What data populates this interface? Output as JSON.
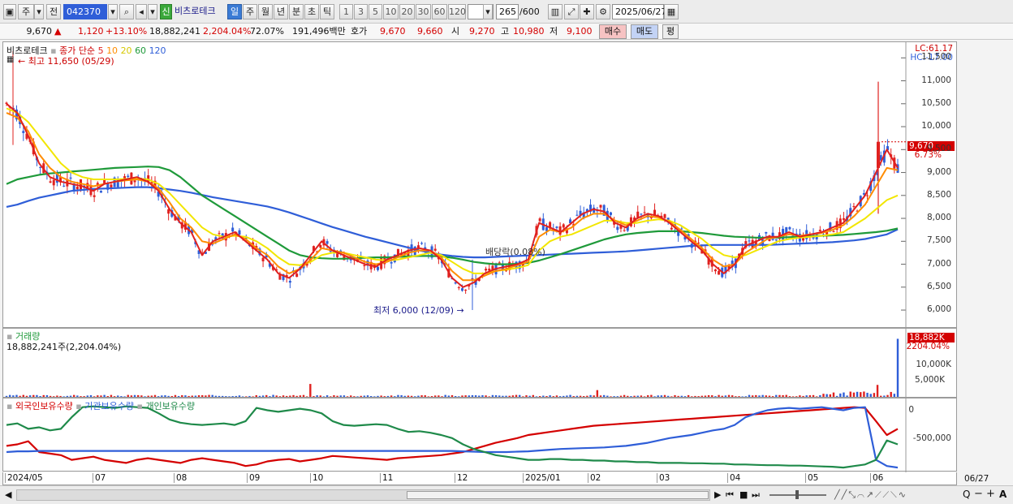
{
  "toolbar": {
    "market": "주",
    "all": "전",
    "code": "042370",
    "credit_badge": "신",
    "stock_name": "비츠로테크",
    "periods": [
      "일",
      "주",
      "월",
      "년",
      "분",
      "초",
      "틱"
    ],
    "numbers": [
      "1",
      "3",
      "5",
      "10",
      "20",
      "30",
      "60",
      "120"
    ],
    "count": "265",
    "count_total": "/600",
    "date": "2025/06/27"
  },
  "quote": {
    "price": "9,670",
    "up_arrow": "▲",
    "change": "1,120",
    "rate": "+13.10%",
    "volume": "18,882,241",
    "vol_rate": "2,204.04%",
    "turnover": "72.07%",
    "amount": "191,496백만",
    "hoga_label": "호가",
    "ask": "9,670",
    "bid": "9,660",
    "open_label": "시",
    "open": "9,270",
    "high_label": "고",
    "high": "10,980",
    "low_label": "저",
    "low": "9,100",
    "buy": "매수",
    "sell": "매도",
    "avg": "평"
  },
  "price_panel": {
    "name": "비츠로테크",
    "legend_prefix": "종가 단순",
    "ma": [
      {
        "label": "5",
        "color": "#e0211f"
      },
      {
        "label": "10",
        "color": "#ff8c00"
      },
      {
        "label": "20",
        "color": "#f2e600"
      },
      {
        "label": "60",
        "color": "#1f9a3a"
      },
      {
        "label": "120",
        "color": "#2f5ed8"
      }
    ],
    "high_note": "최고 11,650 (05/29)",
    "low_note": "최저 6,000 (12/09)",
    "dividend_note": "배당락(0.08%)",
    "lc": "LC:61.17",
    "hc": "HC:-17.00",
    "last_price": "9,670",
    "last_rate": "6.73%",
    "y_ticks": [
      "11,500",
      "11,000",
      "10,500",
      "10,000",
      "9,500",
      "9,000",
      "8,500",
      "8,000",
      "7,500",
      "7,000",
      "6,500",
      "6,000"
    ]
  },
  "volume_panel": {
    "title": "거래량",
    "value": "18,882,241주(2,204.04%)",
    "last_value": "18,882K",
    "last_rate": "2204.04%",
    "y_ticks": [
      "10,000K",
      "5,000K"
    ]
  },
  "holdings_panel": {
    "series": [
      {
        "name": "외국인보유수량",
        "color": "#d40000"
      },
      {
        "name": "기관보유수량",
        "color": "#2f5ed8"
      },
      {
        "name": "개인보유수량",
        "color": "#1f8a4a"
      }
    ],
    "y_ticks": [
      "0",
      "-500,000"
    ]
  },
  "x_axis": [
    "2024/05",
    "07",
    "08",
    "09",
    "10",
    "11",
    "12",
    "2025/01",
    "02",
    "03",
    "04",
    "05",
    "06"
  ],
  "x_axis_right": "06/27",
  "chart_data": [
    {
      "type": "line",
      "title": "비츠로테크",
      "ylim": [
        5700,
        11700
      ],
      "high": 11650,
      "low": 6000,
      "last": 9670,
      "ma5": [
        10500,
        10300,
        9800,
        9200,
        8900,
        8800,
        8750,
        8700,
        8600,
        8750,
        8800,
        8850,
        8900,
        8800,
        8600,
        8200,
        7900,
        7700,
        7200,
        7500,
        7600,
        7700,
        7500,
        7300,
        7100,
        6800,
        6700,
        6900,
        7200,
        7500,
        7300,
        7200,
        7100,
        7000,
        6950,
        7100,
        7200,
        7300,
        7350,
        7300,
        7100,
        6700,
        6500,
        6600,
        6800,
        6900,
        6950,
        7000,
        7100,
        7900,
        7800,
        7700,
        7900,
        8100,
        8200,
        8150,
        7900,
        7800,
        8000,
        8100,
        8050,
        7900,
        7700,
        7500,
        7300,
        7000,
        6800,
        7000,
        7400,
        7500,
        7600,
        7600,
        7700,
        7600,
        7650,
        7700,
        7800,
        7900,
        8200,
        8500,
        9000,
        9500,
        9100
      ],
      "ma10": [
        10300,
        10200,
        9900,
        9400,
        9100,
        8900,
        8800,
        8750,
        8700,
        8750,
        8800,
        8830,
        8850,
        8800,
        8650,
        8350,
        8000,
        7800,
        7500,
        7450,
        7550,
        7650,
        7550,
        7350,
        7200,
        6950,
        6800,
        6900,
        7100,
        7350,
        7300,
        7250,
        7150,
        7050,
        7000,
        7050,
        7150,
        7250,
        7300,
        7300,
        7150,
        6850,
        6650,
        6650,
        6750,
        6850,
        6900,
        6980,
        7050,
        7600,
        7750,
        7700,
        7800,
        8000,
        8100,
        8100,
        7950,
        7850,
        7950,
        8050,
        8020,
        7930,
        7750,
        7550,
        7350,
        7100,
        6950,
        7000,
        7250,
        7400,
        7550,
        7600,
        7650,
        7620,
        7650,
        7680,
        7750,
        7850,
        8050,
        8300,
        8700,
        9100,
        9050
      ],
      "ma20": [
        10400,
        10300,
        10100,
        9800,
        9500,
        9200,
        9000,
        8900,
        8850,
        8850,
        8850,
        8860,
        8870,
        8850,
        8750,
        8550,
        8300,
        8050,
        7800,
        7650,
        7600,
        7620,
        7600,
        7500,
        7350,
        7150,
        7000,
        6980,
        7050,
        7200,
        7250,
        7250,
        7200,
        7150,
        7100,
        7080,
        7100,
        7150,
        7200,
        7250,
        7200,
        7050,
        6900,
        6800,
        6800,
        6850,
        6880,
        6920,
        6980,
        7300,
        7500,
        7600,
        7650,
        7750,
        7850,
        7950,
        7950,
        7900,
        7900,
        7950,
        7980,
        7950,
        7850,
        7700,
        7550,
        7350,
        7200,
        7150,
        7200,
        7300,
        7400,
        7500,
        7550,
        7580,
        7600,
        7620,
        7650,
        7700,
        7850,
        8000,
        8200,
        8400,
        8500
      ],
      "ma60": [
        8750,
        8850,
        8900,
        8950,
        8980,
        9000,
        9020,
        9040,
        9060,
        9080,
        9100,
        9110,
        9120,
        9130,
        9120,
        9050,
        8900,
        8700,
        8500,
        8350,
        8200,
        8050,
        7900,
        7750,
        7600,
        7450,
        7300,
        7200,
        7150,
        7130,
        7120,
        7120,
        7130,
        7140,
        7150,
        7150,
        7160,
        7170,
        7180,
        7180,
        7170,
        7140,
        7100,
        7050,
        7020,
        7000,
        7000,
        7010,
        7030,
        7080,
        7150,
        7220,
        7300,
        7380,
        7460,
        7540,
        7600,
        7650,
        7680,
        7700,
        7720,
        7720,
        7720,
        7700,
        7680,
        7650,
        7620,
        7600,
        7590,
        7580,
        7580,
        7580,
        7590,
        7600,
        7610,
        7620,
        7630,
        7640,
        7660,
        7680,
        7700,
        7730,
        7780
      ],
      "ma120": [
        8250,
        8300,
        8380,
        8450,
        8500,
        8550,
        8600,
        8620,
        8640,
        8650,
        8660,
        8670,
        8680,
        8680,
        8660,
        8630,
        8600,
        8560,
        8510,
        8460,
        8420,
        8380,
        8340,
        8300,
        8260,
        8200,
        8130,
        8050,
        7970,
        7890,
        7810,
        7740,
        7670,
        7600,
        7540,
        7480,
        7420,
        7360,
        7300,
        7250,
        7210,
        7180,
        7160,
        7150,
        7150,
        7160,
        7170,
        7180,
        7190,
        7200,
        7210,
        7220,
        7230,
        7240,
        7250,
        7260,
        7270,
        7280,
        7300,
        7320,
        7340,
        7360,
        7380,
        7400,
        7410,
        7420,
        7420,
        7420,
        7420,
        7420,
        7420,
        7430,
        7440,
        7450,
        7460,
        7470,
        7480,
        7500,
        7520,
        7550,
        7600,
        7650,
        7760
      ]
    },
    {
      "type": "bar",
      "title": "거래량",
      "last": 18882241,
      "ylim": [
        0,
        19000000
      ]
    },
    {
      "type": "line",
      "title": "보유수량",
      "ylim": [
        -820000,
        50000
      ],
      "series": [
        {
          "name": "외국인보유수량",
          "values": [
            -520000,
            -500000,
            -460000,
            -600000,
            -620000,
            -640000,
            -700000,
            -680000,
            -660000,
            -700000,
            -720000,
            -740000,
            -700000,
            -680000,
            -700000,
            -720000,
            -740000,
            -700000,
            -680000,
            -700000,
            -720000,
            -740000,
            -780000,
            -760000,
            -720000,
            -700000,
            -690000,
            -720000,
            -700000,
            -680000,
            -650000,
            -660000,
            -670000,
            -680000,
            -690000,
            -700000,
            -680000,
            -670000,
            -660000,
            -650000,
            -640000,
            -620000,
            -600000,
            -560000,
            -520000,
            -480000,
            -450000,
            -420000,
            -380000,
            -360000,
            -340000,
            -320000,
            -300000,
            -280000,
            -260000,
            -250000,
            -240000,
            -230000,
            -220000,
            -210000,
            -200000,
            -190000,
            -180000,
            -170000,
            -160000,
            -150000,
            -140000,
            -130000,
            -120000,
            -110000,
            -100000,
            -90000,
            -80000,
            -70000,
            -60000,
            -50000,
            -40000,
            -30000,
            -20000,
            -30000,
            -200000,
            -380000,
            -300000
          ]
        },
        {
          "name": "기관보유수량",
          "values": [
            -600000,
            -590000,
            -590000,
            -585000,
            -585000,
            -585000,
            -585000,
            -585000,
            -585000,
            -585000,
            -585000,
            -585000,
            -585000,
            -585000,
            -585000,
            -585000,
            -585000,
            -585000,
            -585000,
            -585000,
            -585000,
            -585000,
            -585000,
            -585000,
            -585000,
            -585000,
            -585000,
            -585000,
            -585000,
            -585000,
            -585000,
            -585000,
            -585000,
            -585000,
            -585000,
            -585000,
            -585000,
            -585000,
            -585000,
            -585000,
            -585000,
            -585000,
            -590000,
            -595000,
            -600000,
            -600000,
            -600000,
            -595000,
            -590000,
            -580000,
            -570000,
            -560000,
            -555000,
            -550000,
            -545000,
            -540000,
            -530000,
            -520000,
            -500000,
            -480000,
            -450000,
            -420000,
            -400000,
            -380000,
            -350000,
            -320000,
            -300000,
            -250000,
            -150000,
            -100000,
            -60000,
            -40000,
            -30000,
            -40000,
            -30000,
            -20000,
            -40000,
            -60000,
            -30000,
            -20000,
            -700000,
            -780000,
            -800000
          ]
        },
        {
          "name": "개인보유수량",
          "values": [
            -250000,
            -230000,
            -300000,
            -280000,
            -320000,
            -300000,
            -150000,
            -20000,
            -10000,
            -20000,
            -30000,
            -10000,
            -20000,
            -30000,
            -100000,
            -180000,
            -220000,
            -240000,
            -250000,
            -240000,
            -230000,
            -250000,
            -200000,
            -30000,
            -60000,
            -80000,
            -60000,
            -40000,
            -60000,
            -100000,
            -200000,
            -250000,
            -260000,
            -250000,
            -240000,
            -250000,
            -300000,
            -340000,
            -330000,
            -350000,
            -380000,
            -420000,
            -500000,
            -560000,
            -600000,
            -640000,
            -660000,
            -680000,
            -700000,
            -700000,
            -690000,
            -690000,
            -700000,
            -700000,
            -710000,
            -710000,
            -720000,
            -720000,
            -730000,
            -730000,
            -740000,
            -740000,
            -740000,
            -745000,
            -745000,
            -750000,
            -750000,
            -760000,
            -760000,
            -765000,
            -770000,
            -770000,
            -775000,
            -775000,
            -780000,
            -785000,
            -790000,
            -800000,
            -780000,
            -760000,
            -700000,
            -450000,
            -500000
          ]
        }
      ]
    }
  ]
}
